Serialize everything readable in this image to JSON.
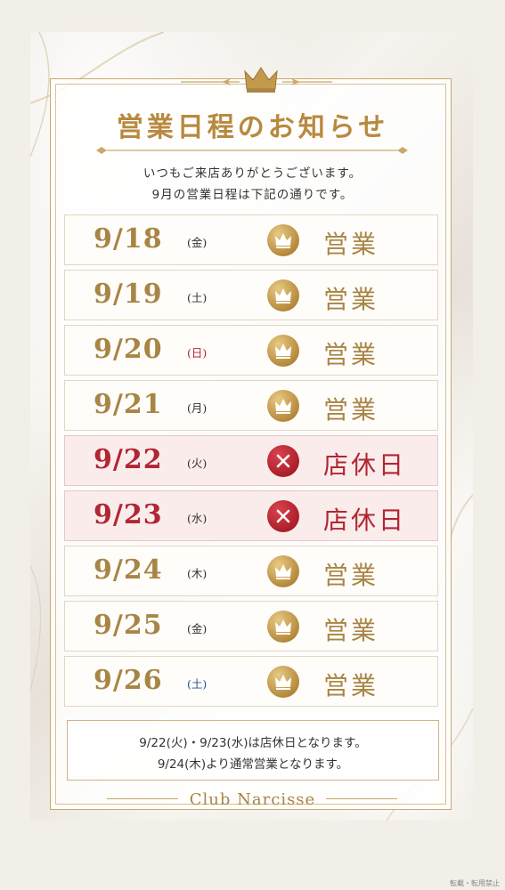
{
  "title": "営業日程のお知らせ",
  "intro": [
    "いつもご来店ありがとうございます。",
    "9月の営業日程は下記の通りです。"
  ],
  "schedule": [
    {
      "date": "9/18",
      "dow": "(金)",
      "dow_type": "weekday",
      "status": "営業",
      "icon": "crown-icon",
      "open": true
    },
    {
      "date": "9/19",
      "dow": "(土)",
      "dow_type": "weekday",
      "status": "営業",
      "icon": "crown-icon",
      "open": true
    },
    {
      "date": "9/20",
      "dow": "(日)",
      "dow_type": "sun",
      "status": "営業",
      "icon": "crown-icon",
      "open": true
    },
    {
      "date": "9/21",
      "dow": "(月)",
      "dow_type": "weekday",
      "status": "営業",
      "icon": "crown-icon",
      "open": true
    },
    {
      "date": "9/22",
      "dow": "(火)",
      "dow_type": "weekday",
      "status": "店休日",
      "icon": "x-icon",
      "open": false
    },
    {
      "date": "9/23",
      "dow": "(水)",
      "dow_type": "weekday",
      "status": "店休日",
      "icon": "x-icon",
      "open": false
    },
    {
      "date": "9/24",
      "dow": "(木)",
      "dow_type": "weekday",
      "status": "営業",
      "icon": "crown-icon",
      "open": true
    },
    {
      "date": "9/25",
      "dow": "(金)",
      "dow_type": "weekday",
      "status": "営業",
      "icon": "crown-icon",
      "open": true
    },
    {
      "date": "9/26",
      "dow": "(土)",
      "dow_type": "sat",
      "status": "営業",
      "icon": "crown-icon",
      "open": true
    }
  ],
  "notes": [
    "9/22(火)・9/23(水)は店休日となります。",
    "9/24(木)より通常営業となります。"
  ],
  "brand": "Club Narcisse",
  "watermark": "転載・転用禁止",
  "colors": {
    "gold": "#a88545",
    "red": "#b02632",
    "blue": "#2b4f9a"
  }
}
